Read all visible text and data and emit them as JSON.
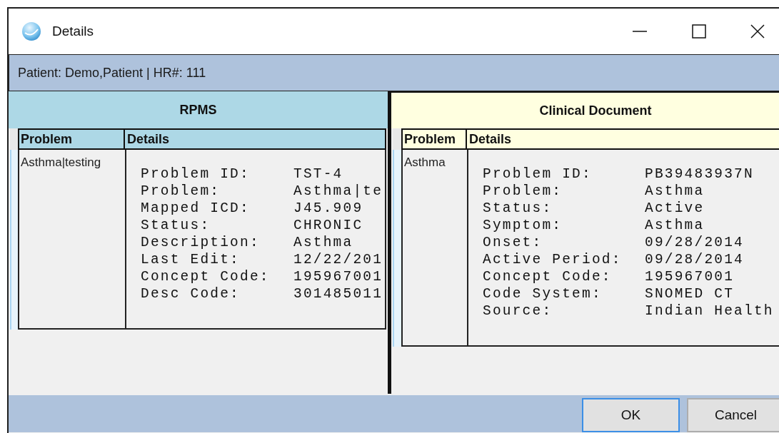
{
  "window": {
    "title": "Details"
  },
  "patient_bar": "Patient: Demo,Patient | HR#: 111",
  "panels": [
    {
      "title": "RPMS",
      "color": "#add8e6",
      "columns": [
        "Problem",
        "Details"
      ],
      "rows": [
        {
          "problem": "Asthma|testing",
          "details": [
            {
              "label": "Problem ID:",
              "value": "TST-4"
            },
            {
              "label": "Problem:",
              "value": "Asthma|te"
            },
            {
              "label": "Mapped ICD:",
              "value": "J45.909"
            },
            {
              "label": "Status:",
              "value": "CHRONIC"
            },
            {
              "label": "Description:",
              "value": "Asthma"
            },
            {
              "label": "Last Edit:",
              "value": "12/22/201"
            },
            {
              "label": "Concept Code:",
              "value": "195967001"
            },
            {
              "label": "Desc Code:",
              "value": "301485011"
            }
          ]
        }
      ]
    },
    {
      "title": "Clinical Document",
      "color": "#ffffe0",
      "columns": [
        "Problem",
        "Details"
      ],
      "rows": [
        {
          "problem": "Asthma",
          "details": [
            {
              "label": "Problem ID:",
              "value": "PB39483937N"
            },
            {
              "label": "Problem:",
              "value": "Asthma"
            },
            {
              "label": "Status:",
              "value": "Active"
            },
            {
              "label": "Symptom:",
              "value": "Asthma"
            },
            {
              "label": "Onset:",
              "value": "09/28/2014"
            },
            {
              "label": "Active Period:",
              "value": "09/28/2014"
            },
            {
              "label": "Concept Code:",
              "value": "195967001"
            },
            {
              "label": "Code System:",
              "value": "SNOMED CT"
            },
            {
              "label": "Source:",
              "value": "Indian Health"
            }
          ]
        }
      ]
    }
  ],
  "buttons": [
    {
      "label": "OK",
      "focused": true
    },
    {
      "label": "Cancel",
      "focused": false
    }
  ]
}
